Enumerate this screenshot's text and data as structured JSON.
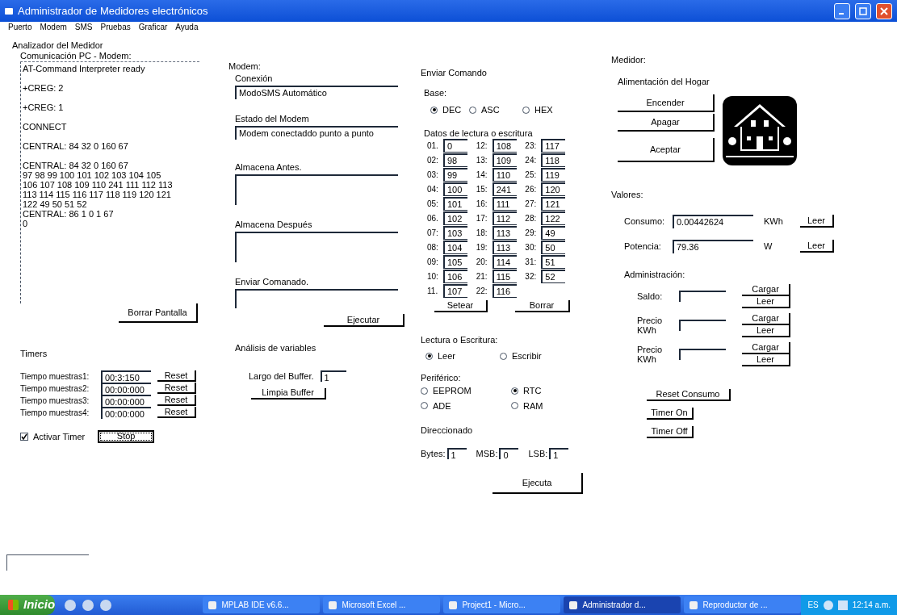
{
  "window": {
    "title": "Administrador de Medidores electrónicos"
  },
  "menu": [
    "Puerto",
    "Modem",
    "SMS",
    "Pruebas",
    "Graficar",
    "Ayuda"
  ],
  "analyzer": {
    "title": "Analizador del Medidor",
    "log_label": "Comunicación PC - Modem:",
    "log_blocks": [
      "AT-Command Interpreter ready",
      "+CREG: 2",
      "+CREG: 1",
      "CONNECT",
      "CENTRAL: 84 32 0 160 67",
      "CENTRAL: 84 32 0 160 67\n97 98 99 100 101 102 103 104 105\n106 107 108 109 110 241 111 112 113\n113 114 115 116 117 118 119 120 121\n122 49 50 51 52\nCENTRAL: 86 1 0 1 67\n0"
    ],
    "clear_button": "Borrar Pantalla"
  },
  "timers": {
    "title": "Timers",
    "rows": [
      {
        "label": "Tiempo muestras1:",
        "value": "00:3:150",
        "button": "Reset"
      },
      {
        "label": "Tiempo muestras2:",
        "value": "00:00:000",
        "button": "Reset"
      },
      {
        "label": "Tiempo muestras3:",
        "value": "00:00:000",
        "button": "Reset"
      },
      {
        "label": "Tiempo muestras4:",
        "value": "00:00:000",
        "button": "Reset"
      }
    ],
    "activate": {
      "label": "Activar Timer",
      "checked": true
    },
    "stop_button": "Stop"
  },
  "modem": {
    "title": "Modem:",
    "fields": [
      {
        "label": "Conexión",
        "value": "ModoSMS Automático",
        "kind": "line"
      },
      {
        "label": "Estado del Modem",
        "value": "Modem conectaddo punto a punto",
        "kind": "line"
      },
      {
        "label": "Almacena  Antes.",
        "kind": "box"
      },
      {
        "label": "Almacena Después",
        "kind": "box"
      },
      {
        "label": "Enviar Comanado.",
        "kind": "line"
      }
    ],
    "execute_button": "Ejecutar",
    "analysis_title": "Análisis de variables",
    "buffer_label": "Largo del Buffer.",
    "buffer_value": "1",
    "clear_buffer_button": "Limpia Buffer"
  },
  "send": {
    "title": "Enviar Comando",
    "base_label": "Base:",
    "base_options": [
      {
        "label": "DEC",
        "selected": true
      },
      {
        "label": "ASC",
        "selected": false
      },
      {
        "label": "HEX",
        "selected": false
      }
    ],
    "data_label": "Datos de lectura o escritura",
    "data": [
      {
        "index": "01.",
        "value": "0"
      },
      {
        "index": "02:",
        "value": "98"
      },
      {
        "index": "03:",
        "value": "99"
      },
      {
        "index": "04:",
        "value": "100"
      },
      {
        "index": "05:",
        "value": "101"
      },
      {
        "index": "06.",
        "value": "102"
      },
      {
        "index": "07:",
        "value": "103"
      },
      {
        "index": "08:",
        "value": "104"
      },
      {
        "index": "09:",
        "value": "105"
      },
      {
        "index": "10:",
        "value": "106"
      },
      {
        "index": "11.",
        "value": "107"
      },
      {
        "index": "12:",
        "value": "108"
      },
      {
        "index": "13:",
        "value": "109"
      },
      {
        "index": "14:",
        "value": "110"
      },
      {
        "index": "15:",
        "value": "241"
      },
      {
        "index": "16:",
        "value": "111"
      },
      {
        "index": "17:",
        "value": "112"
      },
      {
        "index": "18:",
        "value": "113"
      },
      {
        "index": "19:",
        "value": "113"
      },
      {
        "index": "20:",
        "value": "114"
      },
      {
        "index": "21:",
        "value": "115"
      },
      {
        "index": "22:",
        "value": "116"
      },
      {
        "index": "23:",
        "value": "117"
      },
      {
        "index": "24:",
        "value": "118"
      },
      {
        "index": "25:",
        "value": "119"
      },
      {
        "index": "26:",
        "value": "120"
      },
      {
        "index": "27:",
        "value": "121"
      },
      {
        "index": "28:",
        "value": "122"
      },
      {
        "index": "29:",
        "value": "49"
      },
      {
        "index": "30:",
        "value": "50"
      },
      {
        "index": "31:",
        "value": "51"
      },
      {
        "index": "32:",
        "value": "52"
      }
    ],
    "set_button": "Setear",
    "clear_button": "Borrar",
    "rw_label": "Lectura o Escritura:",
    "rw_options": [
      {
        "label": "Leer",
        "selected": true
      },
      {
        "label": "Escribir",
        "selected": false
      }
    ],
    "peripheral_label": "Periférico:",
    "peripheral_options": [
      {
        "label": "EEPROM",
        "selected": false
      },
      {
        "label": "RTC",
        "selected": true
      },
      {
        "label": "ADE",
        "selected": false
      },
      {
        "label": "RAM",
        "selected": false
      }
    ],
    "addressing_label": "Direccionado",
    "address_fields": [
      {
        "label": "Bytes:",
        "value": "1"
      },
      {
        "label": "MSB:",
        "value": "0"
      },
      {
        "label": "LSB:",
        "value": "1"
      }
    ],
    "execute_button": "Ejecuta"
  },
  "meter": {
    "title": "Medidor:",
    "power_label": "Alimentación del Hogar",
    "power_buttons": [
      "Encender",
      "Apagar",
      "Aceptar"
    ],
    "values_label": "Valores:",
    "readings": [
      {
        "label": "Consumo:",
        "value": "0.00442624",
        "unit": "KWh",
        "button": "Leer"
      },
      {
        "label": "Potencia:",
        "value": "79.36",
        "unit": "W",
        "button": "Leer"
      }
    ],
    "admin_label": "Administración:",
    "admin_rows": [
      {
        "label": "Saldo:",
        "buttons": [
          "Cargar",
          "Leer"
        ]
      },
      {
        "label": "Precio KWh",
        "buttons": [
          "Cargar",
          "Leer"
        ]
      },
      {
        "label": "Precio KWh",
        "buttons": [
          "Cargar",
          "Leer"
        ]
      }
    ],
    "actions": [
      "Reset Consumo",
      "Timer On",
      "Timer Off"
    ]
  },
  "taskbar": {
    "start": "Inicio",
    "tasks": [
      {
        "label": "MPLAB IDE v6.6...",
        "selected": false
      },
      {
        "label": "Microsoft Excel ...",
        "selected": false
      },
      {
        "label": "Project1 - Micro...",
        "selected": false
      },
      {
        "label": "Administrador d...",
        "selected": true
      },
      {
        "label": "Reproductor de ...",
        "selected": false
      }
    ],
    "language": "ES",
    "time": "12:14 a.m."
  }
}
